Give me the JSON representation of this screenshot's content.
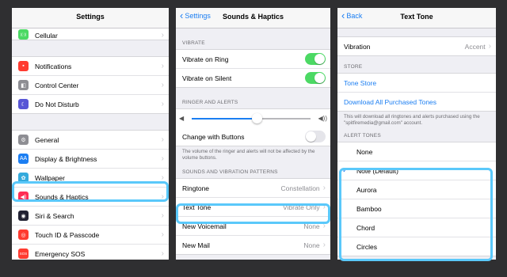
{
  "settings": {
    "title": "Settings",
    "items1": [
      {
        "label": "Cellular",
        "icon": "cellular-icon",
        "color": "#4cd964",
        "glyph": "((·))"
      }
    ],
    "items2": [
      {
        "label": "Notifications",
        "icon": "notifications-icon",
        "color": "#ff3b30",
        "glyph": "▪"
      },
      {
        "label": "Control Center",
        "icon": "control-center-icon",
        "color": "#8e8e93",
        "glyph": "◧"
      },
      {
        "label": "Do Not Disturb",
        "icon": "moon-icon",
        "color": "#5856d6",
        "glyph": "☾"
      }
    ],
    "items3": [
      {
        "label": "General",
        "icon": "gear-icon",
        "color": "#8e8e93",
        "glyph": "⚙"
      },
      {
        "label": "Display & Brightness",
        "icon": "display-brightness-icon",
        "color": "#1b7ef2",
        "glyph": "AA"
      },
      {
        "label": "Wallpaper",
        "icon": "wallpaper-icon",
        "color": "#34aadc",
        "glyph": "✿"
      },
      {
        "label": "Sounds & Haptics",
        "icon": "speaker-icon",
        "color": "#ff2d55",
        "glyph": "◀)"
      },
      {
        "label": "Siri & Search",
        "icon": "siri-icon",
        "color": "#222233",
        "glyph": "◉"
      },
      {
        "label": "Touch ID & Passcode",
        "icon": "fingerprint-icon",
        "color": "#ff3b30",
        "glyph": "◎"
      },
      {
        "label": "Emergency SOS",
        "icon": "sos-icon",
        "color": "#ff3b30",
        "glyph": "SOS"
      }
    ]
  },
  "sounds": {
    "back": "Settings",
    "title": "Sounds & Haptics",
    "vibrate_header": "VIBRATE",
    "vibrate_ring": "Vibrate on Ring",
    "vibrate_silent": "Vibrate on Silent",
    "ringer_header": "RINGER AND ALERTS",
    "volume_level": 0.55,
    "change_buttons": "Change with Buttons",
    "ringer_note": "The volume of the ringer and alerts will not be affected by the volume buttons.",
    "patterns_header": "SOUNDS AND VIBRATION PATTERNS",
    "patterns": [
      {
        "label": "Ringtone",
        "value": "Constellation"
      },
      {
        "label": "Text Tone",
        "value": "Vibrate Only"
      },
      {
        "label": "New Voicemail",
        "value": "None"
      },
      {
        "label": "New Mail",
        "value": "None"
      }
    ]
  },
  "texttone": {
    "back": "Back",
    "title": "Text Tone",
    "vibration_label": "Vibration",
    "vibration_value": "Accent",
    "store_header": "STORE",
    "tone_store": "Tone Store",
    "download": "Download All Purchased Tones",
    "store_note": "This will download all ringtones and alerts purchased using the \"spitfiremedia@gmail.com\" account.",
    "alert_header": "ALERT TONES",
    "tones": [
      {
        "label": "None",
        "checked": false
      },
      {
        "label": "Note (Default)",
        "checked": true
      },
      {
        "label": "Aurora",
        "checked": false
      },
      {
        "label": "Bamboo",
        "checked": false
      },
      {
        "label": "Chord",
        "checked": false
      },
      {
        "label": "Circles",
        "checked": false
      }
    ]
  },
  "colors": {
    "accent": "#1b7ef2",
    "highlight": "#5ac8fa",
    "toggle_on": "#4cd964"
  }
}
